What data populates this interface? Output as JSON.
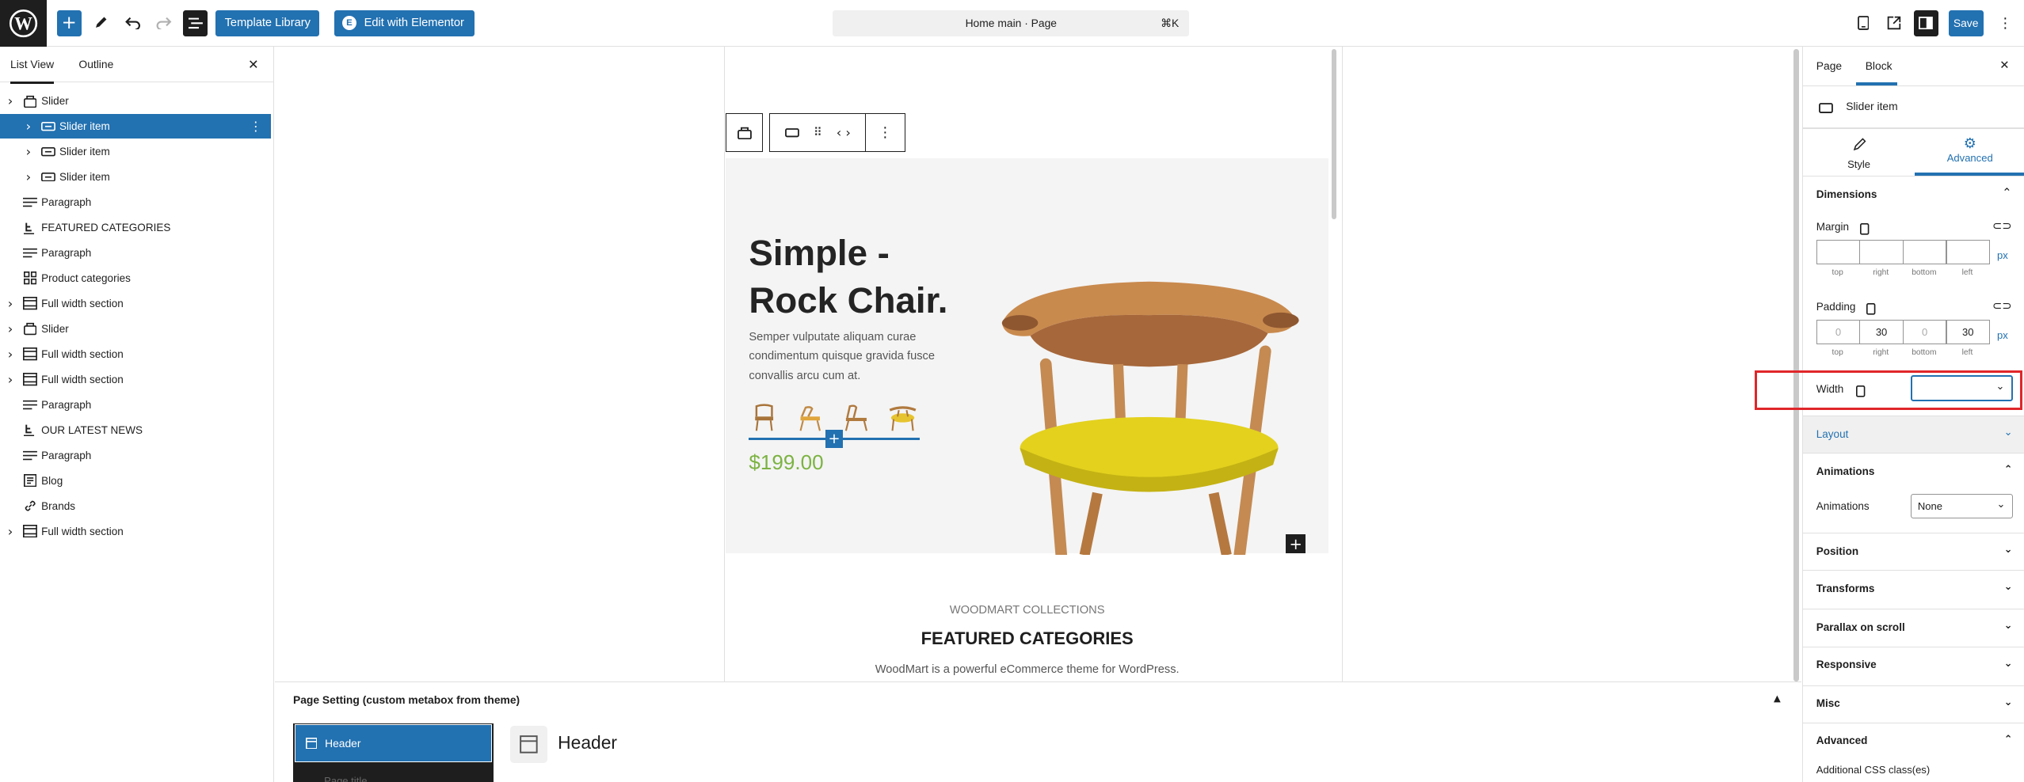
{
  "topbar": {
    "template_library": "Template Library",
    "edit_elementor": "Edit with Elementor",
    "command_title": "Home main · Page",
    "command_shortcut": "⌘K",
    "save": "Save"
  },
  "left_panel": {
    "tabs": [
      "List View",
      "Outline"
    ],
    "items": [
      {
        "label": "Slider",
        "icon": "slider-icon",
        "expandable": true,
        "depth": 0
      },
      {
        "label": "Slider item",
        "icon": "slider-item-icon",
        "expandable": true,
        "depth": 1,
        "selected": true
      },
      {
        "label": "Slider item",
        "icon": "slider-item-icon",
        "expandable": true,
        "depth": 1
      },
      {
        "label": "Slider item",
        "icon": "slider-item-icon",
        "expandable": true,
        "depth": 1
      },
      {
        "label": "Paragraph",
        "icon": "paragraph-icon",
        "expandable": false,
        "depth": 0
      },
      {
        "label": "FEATURED CATEGORIES",
        "icon": "heading-icon",
        "expandable": false,
        "depth": 0
      },
      {
        "label": "Paragraph",
        "icon": "paragraph-icon",
        "expandable": false,
        "depth": 0
      },
      {
        "label": "Product categories",
        "icon": "grid-icon",
        "expandable": false,
        "depth": 0
      },
      {
        "label": "Full width section",
        "icon": "section-icon",
        "expandable": true,
        "depth": 0
      },
      {
        "label": "Slider",
        "icon": "slider-icon",
        "expandable": true,
        "depth": 0
      },
      {
        "label": "Full width section",
        "icon": "section-icon",
        "expandable": true,
        "depth": 0
      },
      {
        "label": "Full width section",
        "icon": "section-icon",
        "expandable": true,
        "depth": 0
      },
      {
        "label": "Paragraph",
        "icon": "paragraph-icon",
        "expandable": false,
        "depth": 0
      },
      {
        "label": "OUR LATEST NEWS",
        "icon": "heading-icon",
        "expandable": false,
        "depth": 0
      },
      {
        "label": "Paragraph",
        "icon": "paragraph-icon",
        "expandable": false,
        "depth": 0
      },
      {
        "label": "Blog",
        "icon": "blog-icon",
        "expandable": false,
        "depth": 0
      },
      {
        "label": "Brands",
        "icon": "brands-icon",
        "expandable": false,
        "depth": 0
      },
      {
        "label": "Full width section",
        "icon": "section-icon",
        "expandable": true,
        "depth": 0
      }
    ]
  },
  "canvas": {
    "hero_title_1": "Simple -",
    "hero_title_2": "Rock Chair.",
    "hero_desc": "Semper vulputate aliquam curae condimentum quisque gravida fusce convallis arcu cum at.",
    "price": "$199.00",
    "collections_label": "WOODMART COLLECTIONS",
    "featured_heading": "FEATURED CATEGORIES",
    "featured_desc": "WoodMart is a powerful eCommerce theme for WordPress."
  },
  "metabox": {
    "title": "Page Setting (custom metabox from theme)",
    "tab_selected": "Header",
    "tab_next": "Page title",
    "content_heading": "Header"
  },
  "right_panel": {
    "tabs": [
      "Page",
      "Block"
    ],
    "block_name": "Slider item",
    "style_tab": "Style",
    "advanced_tab": "Advanced",
    "dimensions": "Dimensions",
    "margin_label": "Margin",
    "margin_values": [
      "",
      "",
      "",
      ""
    ],
    "padding_label": "Padding",
    "padding_values": [
      "0",
      "30",
      "0",
      "30"
    ],
    "side_labels": [
      "top",
      "right",
      "bottom",
      "left"
    ],
    "unit": "px",
    "width_label": "Width",
    "width_value": "",
    "layout": "Layout",
    "animations_section": "Animations",
    "animations_label": "Animations",
    "animations_value": "None",
    "position": "Position",
    "transforms": "Transforms",
    "parallax": "Parallax on scroll",
    "responsive": "Responsive",
    "misc": "Misc",
    "advanced": "Advanced",
    "css_class_label": "Additional CSS class(es)"
  },
  "colors": {
    "accent": "#2271b1",
    "price": "#7cb342",
    "highlight": "#e0262a"
  }
}
